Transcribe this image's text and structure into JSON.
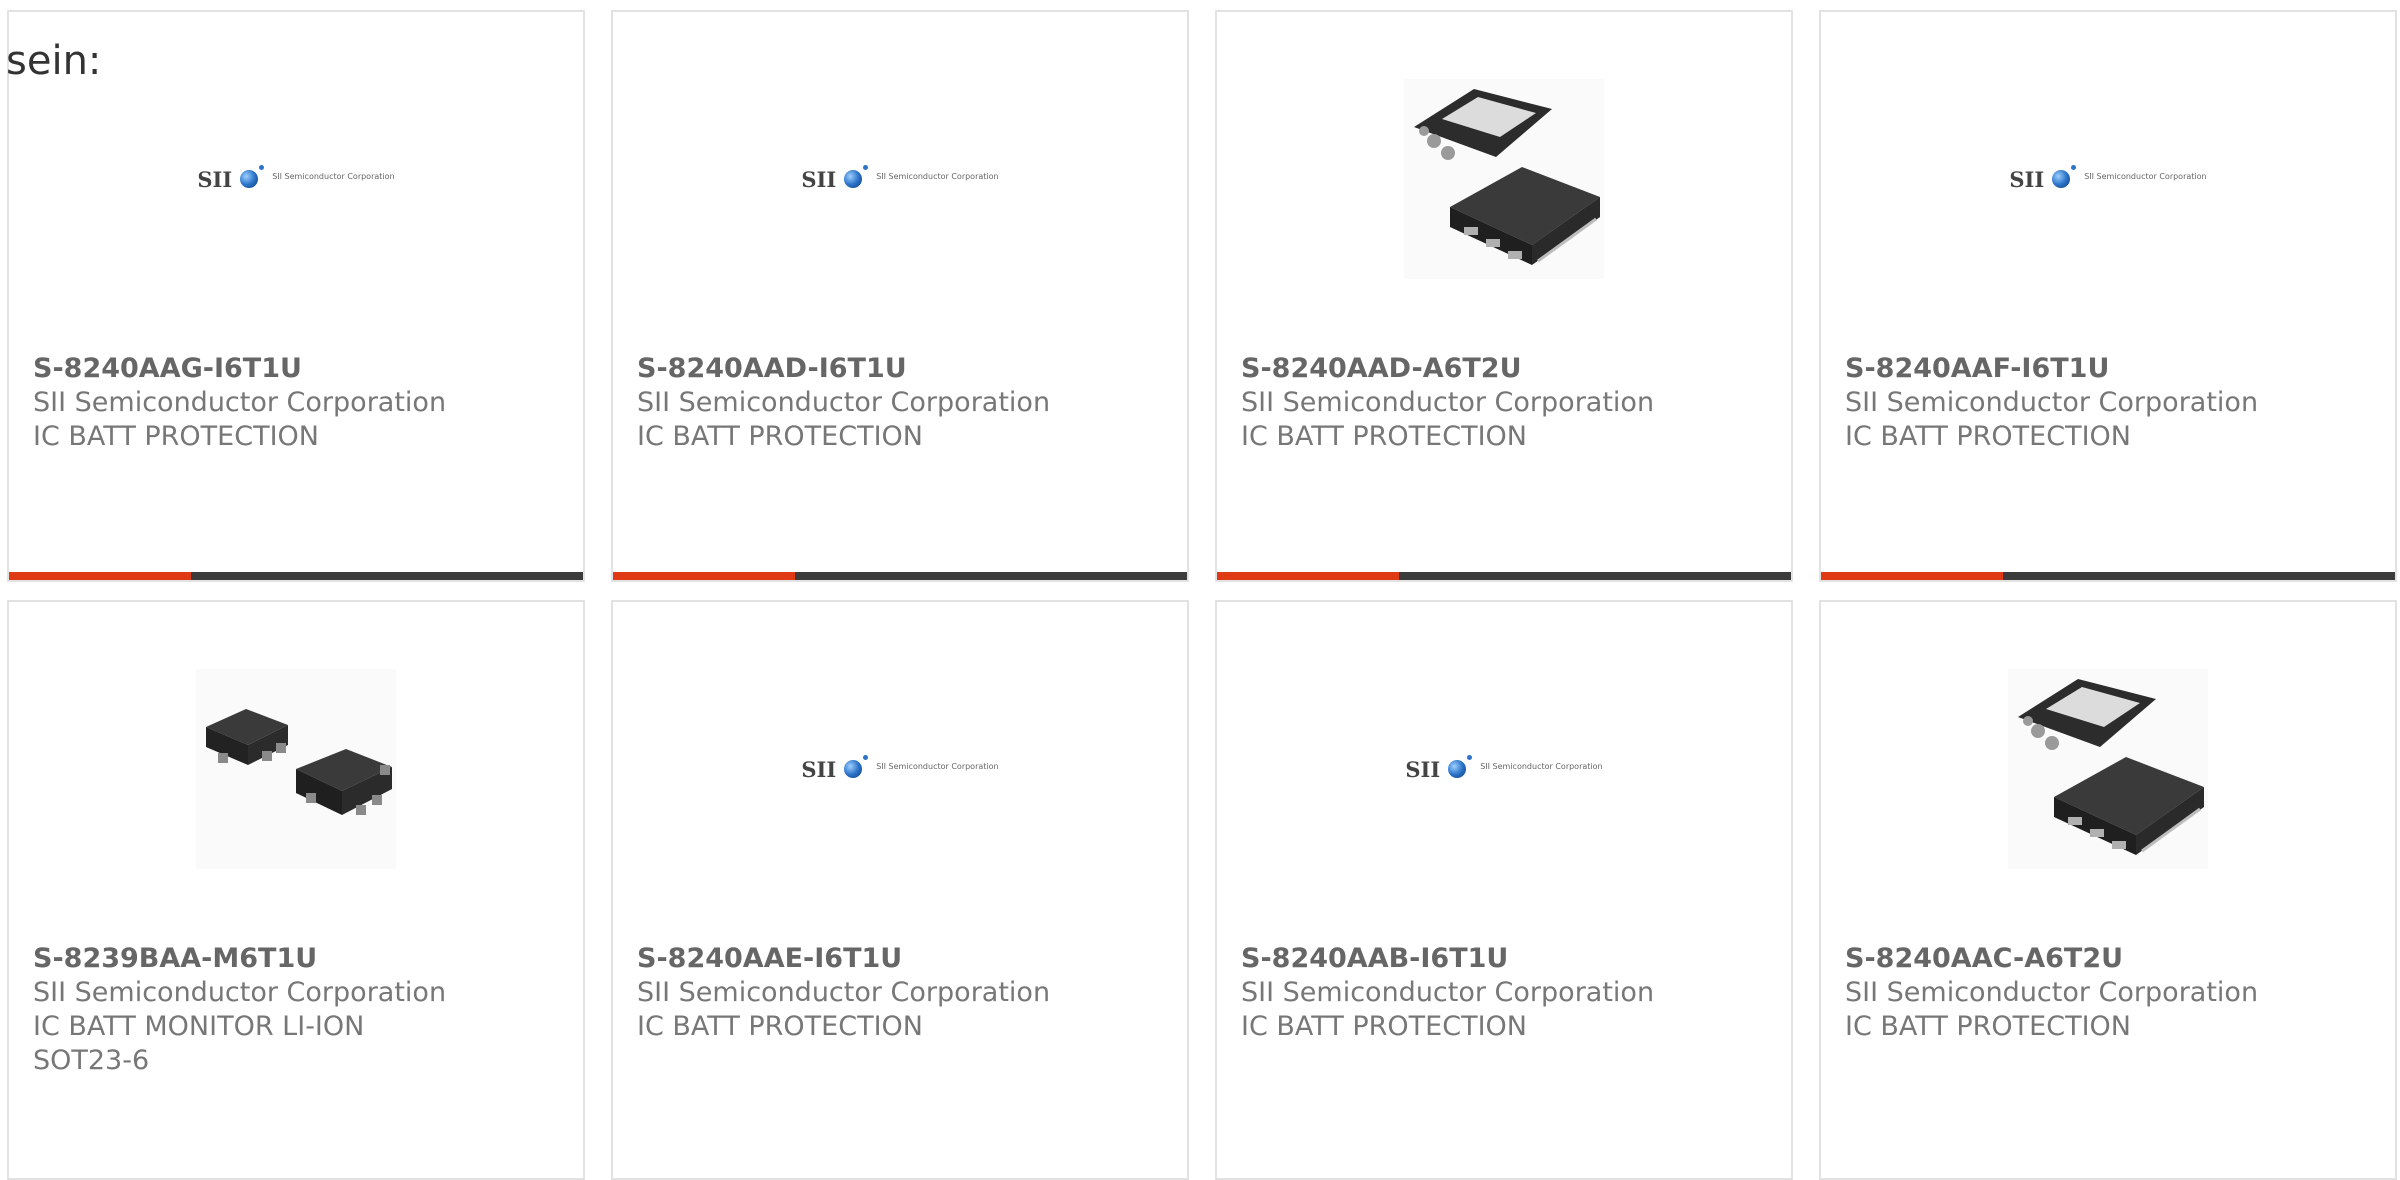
{
  "intro_text": "sein:",
  "logo": {
    "brand": "SII",
    "corp": "SII Semiconductor Corporation"
  },
  "colors": {
    "accent": "#e03a14",
    "bar": "#3b3b3b",
    "border": "#e2e2e2"
  },
  "products": [
    {
      "part": "S-8240AAG-I6T1U",
      "manufacturer": "SII Semiconductor Corporation",
      "desc": [
        "IC BATT PROTECTION"
      ],
      "image": "sii-logo"
    },
    {
      "part": "S-8240AAD-I6T1U",
      "manufacturer": "SII Semiconductor Corporation",
      "desc": [
        "IC BATT PROTECTION"
      ],
      "image": "sii-logo"
    },
    {
      "part": "S-8240AAD-A6T2U",
      "manufacturer": "SII Semiconductor Corporation",
      "desc": [
        "IC BATT PROTECTION"
      ],
      "image": "chip-photo-son"
    },
    {
      "part": "S-8240AAF-I6T1U",
      "manufacturer": "SII Semiconductor Corporation",
      "desc": [
        "IC BATT PROTECTION"
      ],
      "image": "sii-logo"
    },
    {
      "part": "S-8239BAA-M6T1U",
      "manufacturer": "SII Semiconductor Corporation",
      "desc": [
        "IC BATT MONITOR LI-ION",
        "SOT23-6"
      ],
      "image": "chip-photo-sot23"
    },
    {
      "part": "S-8240AAE-I6T1U",
      "manufacturer": "SII Semiconductor Corporation",
      "desc": [
        "IC BATT PROTECTION"
      ],
      "image": "sii-logo"
    },
    {
      "part": "S-8240AAB-I6T1U",
      "manufacturer": "SII Semiconductor Corporation",
      "desc": [
        "IC BATT PROTECTION"
      ],
      "image": "sii-logo"
    },
    {
      "part": "S-8240AAC-A6T2U",
      "manufacturer": "SII Semiconductor Corporation",
      "desc": [
        "IC BATT PROTECTION"
      ],
      "image": "chip-photo-son"
    }
  ]
}
